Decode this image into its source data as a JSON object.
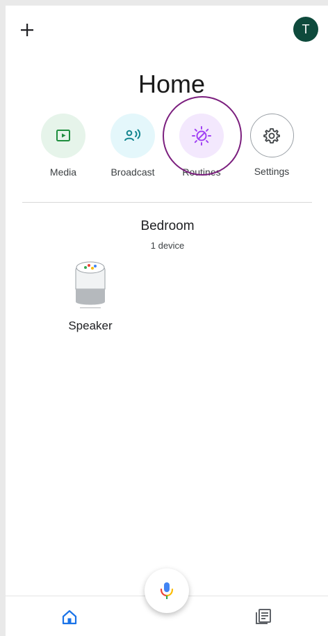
{
  "header": {
    "avatar_initial": "T",
    "page_title": "Home"
  },
  "actions": [
    {
      "label": "Media",
      "icon": "media-icon",
      "bg": "#e6f4ea",
      "fg": "#1e8e3e"
    },
    {
      "label": "Broadcast",
      "icon": "broadcast-icon",
      "bg": "#e4f7fb",
      "fg": "#12858f"
    },
    {
      "label": "Routines",
      "icon": "routines-icon",
      "bg": "#f3e8fd",
      "fg": "#a142f4"
    },
    {
      "label": "Settings",
      "icon": "gear-icon",
      "bg": "#ffffff",
      "fg": "#3c4043"
    }
  ],
  "room": {
    "name": "Bedroom",
    "device_count": "1 device",
    "devices": [
      {
        "name": "Speaker",
        "icon": "google-home-speaker-icon"
      }
    ]
  },
  "bottom_nav": {
    "items": [
      {
        "icon": "home-icon",
        "active": true
      },
      {
        "icon": "feed-icon",
        "active": false
      }
    ],
    "mic": {
      "icon": "mic-icon"
    }
  },
  "colors": {
    "accent_blue": "#1a73e8",
    "avatar_bg": "#0e4a3c",
    "highlight_ring": "#7b1f7e"
  }
}
